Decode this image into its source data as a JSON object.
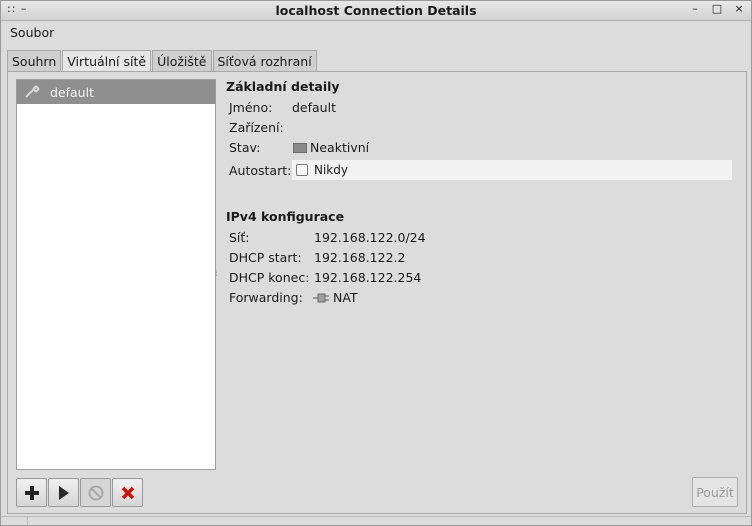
{
  "window": {
    "title": "localhost Connection Details",
    "left_controls": ":: –",
    "min_label": "–",
    "max_label": "□",
    "close_label": "×"
  },
  "menubar": {
    "file": "Soubor"
  },
  "tabs": [
    {
      "label": "Souhrn"
    },
    {
      "label": "Virtuální sítě"
    },
    {
      "label": "Úložiště"
    },
    {
      "label": "Síťová rozhraní"
    }
  ],
  "network_list": {
    "items": [
      {
        "name": "default",
        "icon": "network-icon"
      }
    ]
  },
  "basic": {
    "title": "Základní detaily",
    "name_label": "Jméno:",
    "name_value": "default",
    "device_label": "Zařízení:",
    "device_value": "",
    "state_label": "Stav:",
    "state_value": "Neaktivní",
    "state_icon": "monitor-icon",
    "autostart_label": "Autostart:",
    "autostart_value": "Nikdy",
    "autostart_checked": false
  },
  "ipv4": {
    "title": "IPv4 konfigurace",
    "network_label": "Síť:",
    "network_value": "192.168.122.0/24",
    "dhcp_start_label": "DHCP start:",
    "dhcp_start_value": "192.168.122.2",
    "dhcp_end_label": "DHCP konec:",
    "dhcp_end_value": "192.168.122.254",
    "forwarding_label": "Forwarding:",
    "forwarding_value": "NAT",
    "forwarding_icon": "nat-plug-icon"
  },
  "toolbar": {
    "add": "plus-icon",
    "start": "play-icon",
    "stop": "stop-icon",
    "delete": "delete-icon"
  },
  "apply_label": "Použít",
  "colors": {
    "selection": "#8f8f8f",
    "delete_red": "#cc1111"
  }
}
